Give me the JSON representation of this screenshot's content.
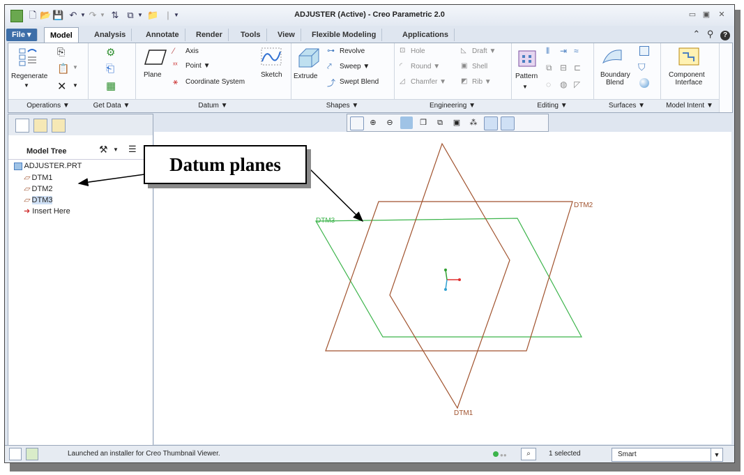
{
  "window": {
    "title": "ADJUSTER (Active) - Creo Parametric 2.0"
  },
  "tabs": [
    "File",
    "Model",
    "Analysis",
    "Annotate",
    "Render",
    "Tools",
    "View",
    "Flexible Modeling",
    "Applications"
  ],
  "active_tab": "Model",
  "ribbon": {
    "operations": {
      "label": "Operations ▼",
      "regenerate": "Regenerate"
    },
    "get_data": {
      "label": "Get Data ▼"
    },
    "datum": {
      "label": "Datum ▼",
      "plane": "Plane",
      "axis": "Axis",
      "point": "Point ▼",
      "coordinate_system": "Coordinate System",
      "sketch": "Sketch"
    },
    "shapes": {
      "label": "Shapes ▼",
      "extrude": "Extrude",
      "revolve": "Revolve",
      "sweep": "Sweep ▼",
      "swept_blend": "Swept Blend"
    },
    "engineering": {
      "label": "Engineering ▼",
      "hole": "Hole",
      "draft": "Draft ▼",
      "round": "Round ▼",
      "shell": "Shell",
      "chamfer": "Chamfer ▼",
      "rib": "Rib ▼"
    },
    "editing": {
      "label": "Editing ▼",
      "pattern": "Pattern"
    },
    "surfaces": {
      "label": "Surfaces ▼",
      "boundary_blend_1": "Boundary",
      "boundary_blend_2": "Blend"
    },
    "model_intent": {
      "label": "Model Intent ▼",
      "component_interface_1": "Component",
      "component_interface_2": "Interface"
    }
  },
  "model_tree": {
    "title": "Model Tree",
    "items": [
      {
        "label": "ADJUSTER.PRT",
        "icon": "part-icon"
      },
      {
        "label": "DTM1",
        "icon": "datum-plane-icon"
      },
      {
        "label": "DTM2",
        "icon": "datum-plane-icon"
      },
      {
        "label": "DTM3",
        "icon": "datum-plane-icon"
      },
      {
        "label": "Insert Here",
        "icon": "insert-arrow-icon"
      }
    ]
  },
  "canvas": {
    "plane_labels": [
      "DTM1",
      "DTM2",
      "DTM3"
    ]
  },
  "callout": {
    "text": "Datum planes"
  },
  "status": {
    "message": "Launched an installer for Creo Thumbnail Viewer.",
    "selected": "1 selected",
    "filter": "Smart"
  },
  "colors": {
    "datum_plane_brown": "#a0522d",
    "datum_plane_green": "#3cb44b"
  }
}
